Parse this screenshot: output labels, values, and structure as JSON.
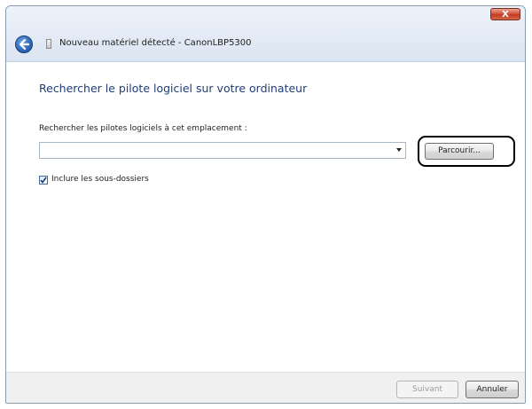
{
  "window": {
    "title": "Nouveau matériel détecté - CanonLBP5300",
    "close_label": "X"
  },
  "content": {
    "heading": "Rechercher le pilote logiciel sur votre ordinateur",
    "path_label": "Rechercher les pilotes logiciels à cet emplacement :",
    "path_value": "",
    "browse_label": "Parcourir...",
    "include_subfolders_label": "Inclure les sous-dossiers",
    "include_subfolders_checked": true
  },
  "footer": {
    "next_label": "Suivant",
    "cancel_label": "Annuler"
  },
  "icons": {
    "back": "back-arrow-icon",
    "device": "hardware-device-icon",
    "close": "close-icon",
    "dropdown": "chevron-down-icon",
    "check": "checkmark-icon"
  },
  "colors": {
    "heading": "#1f3d7a",
    "close_button": "#c13a1f",
    "back_button": "#2b66b8",
    "footer_bg": "#f0f0f0",
    "disabled_text": "#9d9d9d"
  }
}
